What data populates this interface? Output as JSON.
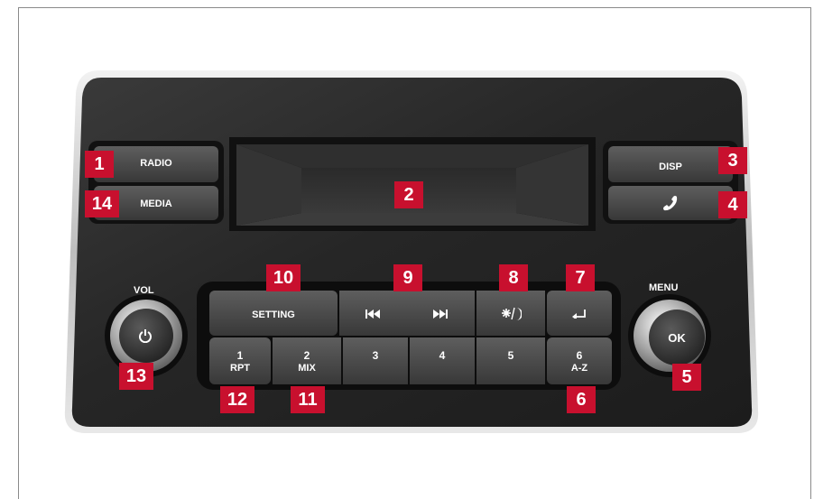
{
  "colors": {
    "panel": "#2b2b2b",
    "button": "#4a4a4a",
    "callout": "#c8102e",
    "bezel": "#d8d8d8"
  },
  "left_buttons": {
    "radio_label": "RADIO",
    "media_label": "MEDIA"
  },
  "right_buttons": {
    "disp_label": "DISP",
    "phone_icon": "phone-handset-icon"
  },
  "knobs": {
    "vol_label": "VOL",
    "power_icon": "power-icon",
    "menu_label": "MENU",
    "ok_label": "OK"
  },
  "top_row": {
    "setting_label": "SETTING",
    "prev_icon": "skip-previous-icon",
    "next_icon": "skip-next-icon",
    "daynight_icon": "sun-moon-icon",
    "back_icon": "back-arrow-icon"
  },
  "bottom_row": [
    {
      "num": "1",
      "sub": "RPT"
    },
    {
      "num": "2",
      "sub": "MIX"
    },
    {
      "num": "3",
      "sub": ""
    },
    {
      "num": "4",
      "sub": ""
    },
    {
      "num": "5",
      "sub": ""
    },
    {
      "num": "6",
      "sub": "A-Z"
    }
  ],
  "callouts": [
    "1",
    "2",
    "3",
    "4",
    "5",
    "6",
    "7",
    "8",
    "9",
    "10",
    "11",
    "12",
    "13",
    "14"
  ]
}
